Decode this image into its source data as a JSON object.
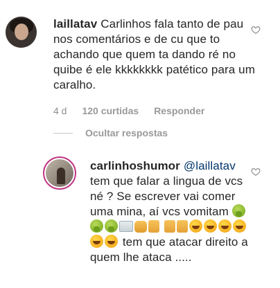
{
  "comment": {
    "username": "laillatav",
    "text": "Carlinhos fala tanto de pau nos comentários e de cu que to achando que quem ta dando ré no quibe é ele kkkkkkkk patético para um caralho.",
    "time": "4 d",
    "likes": "120 curtidas",
    "reply_label": "Responder",
    "hide_replies_label": "Ocultar respostas"
  },
  "reply": {
    "username": "carlinhoshumor",
    "mention": "@laillatav",
    "text_part1": "tem que falar a lingua de vcs né ? Se escrever vai comer uma mina, aí vcs vomitam",
    "text_part2": "tem que atacar direito a quem lhe ataca .....",
    "emojis_row1": [
      "vomit-face",
      "vomit-face",
      "vomit-face",
      "money",
      "fist",
      "thumbs-up"
    ],
    "emojis_row2": [
      "thumbs-up",
      "thumbs-up",
      "rofl",
      "rofl",
      "rofl",
      "rofl",
      "rofl",
      "rofl"
    ]
  },
  "icons": {
    "like_icon": "heart-outline"
  }
}
